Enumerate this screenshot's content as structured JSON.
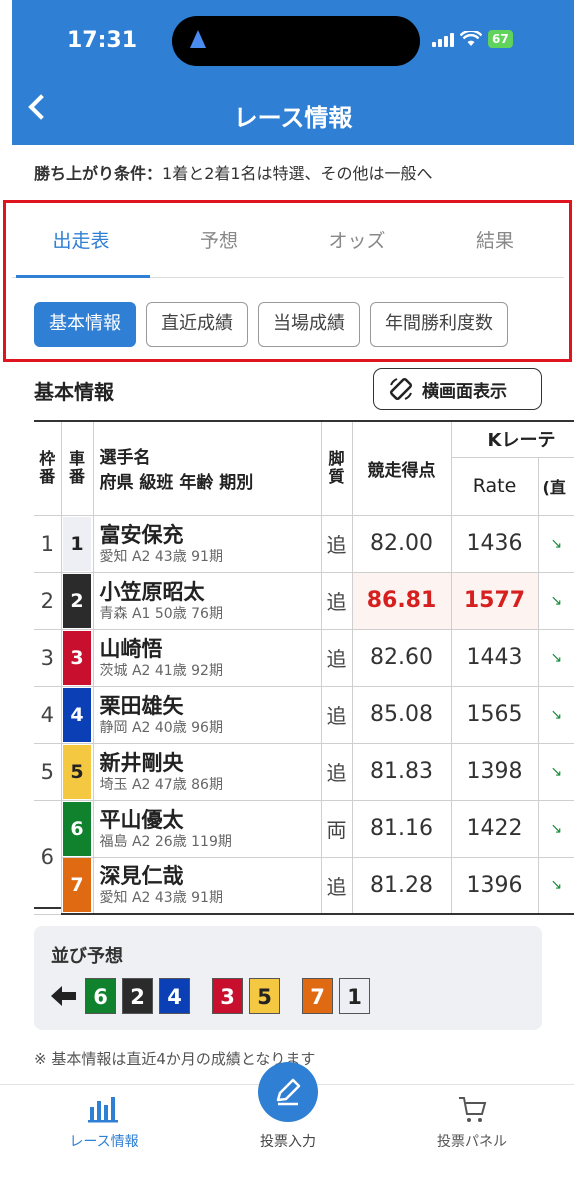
{
  "status_bar": {
    "time": "17:31",
    "battery": "67"
  },
  "header": {
    "title": "レース情報"
  },
  "condition": {
    "label": "勝ち上がり条件：",
    "text": "1着と2着1名は特選、その他は一般へ"
  },
  "tabs": [
    {
      "label": "出走表",
      "active": true
    },
    {
      "label": "予想",
      "active": false
    },
    {
      "label": "オッズ",
      "active": false
    },
    {
      "label": "結果",
      "active": false
    }
  ],
  "subtabs": [
    {
      "label": "基本情報",
      "active": true
    },
    {
      "label": "直近成績",
      "active": false
    },
    {
      "label": "当場成績",
      "active": false
    },
    {
      "label": "年間勝利度数",
      "active": false
    }
  ],
  "section": {
    "title": "基本情報",
    "landscape_button": "横画面表示"
  },
  "table": {
    "headers": {
      "frame": "枠番",
      "car": "車番",
      "rider": "選手名",
      "rider_sub": "府県 級班 年齢 期別",
      "leg": "脚質",
      "score": "競走得点",
      "krace": "Kレーテ",
      "rate": "Rate",
      "trend": "(直"
    },
    "rows": [
      {
        "frame": "1",
        "car": "1",
        "name": "富安保充",
        "profile": "愛知 A2 43歳 91期",
        "leg": "追",
        "score": "82.00",
        "rate": "1436",
        "trend": "↘",
        "color": "#eeeef5",
        "text_color": "#222",
        "highlight": false
      },
      {
        "frame": "2",
        "car": "2",
        "name": "小笠原昭太",
        "profile": "青森 A1 50歳 76期",
        "leg": "追",
        "score": "86.81",
        "rate": "1577",
        "trend": "↘",
        "color": "#2b2b2b",
        "text_color": "#fff",
        "highlight": true
      },
      {
        "frame": "3",
        "car": "3",
        "name": "山崎悟",
        "profile": "茨城 A2 41歳 92期",
        "leg": "追",
        "score": "82.60",
        "rate": "1443",
        "trend": "↘",
        "color": "#c8102e",
        "text_color": "#fff",
        "highlight": false
      },
      {
        "frame": "4",
        "car": "4",
        "name": "栗田雄矢",
        "profile": "静岡 A2 40歳 96期",
        "leg": "追",
        "score": "85.08",
        "rate": "1565",
        "trend": "↘",
        "color": "#0b3fb5",
        "text_color": "#fff",
        "highlight": false
      },
      {
        "frame": "5",
        "car": "5",
        "name": "新井剛央",
        "profile": "埼玉 A2 47歳 86期",
        "leg": "追",
        "score": "81.83",
        "rate": "1398",
        "trend": "↘",
        "color": "#f5c842",
        "text_color": "#222",
        "highlight": false
      },
      {
        "frame": "6",
        "car": "6",
        "name": "平山優太",
        "profile": "福島 A2 26歳 119期",
        "leg": "両",
        "score": "81.16",
        "rate": "1422",
        "trend": "↘",
        "color": "#10822e",
        "text_color": "#fff",
        "highlight": false
      },
      {
        "frame": "",
        "car": "7",
        "name": "深見仁哉",
        "profile": "愛知 A2 43歳 91期",
        "leg": "追",
        "score": "81.28",
        "rate": "1396",
        "trend": "↘",
        "color": "#e06a12",
        "text_color": "#fff",
        "highlight": false
      }
    ]
  },
  "narabi": {
    "title": "並び予想",
    "groups": [
      [
        {
          "n": "6",
          "color": "#10822e",
          "text": "#fff"
        },
        {
          "n": "2",
          "color": "#2b2b2b",
          "text": "#fff"
        },
        {
          "n": "4",
          "color": "#0b3fb5",
          "text": "#fff"
        }
      ],
      [
        {
          "n": "3",
          "color": "#c8102e",
          "text": "#fff"
        },
        {
          "n": "5",
          "color": "#f5c842",
          "text": "#222"
        }
      ],
      [
        {
          "n": "7",
          "color": "#e06a12",
          "text": "#fff"
        }
      ],
      [
        {
          "n": "1",
          "color": "#eeeef5",
          "text": "#222"
        }
      ]
    ]
  },
  "notes": {
    "note1": "※ 基本情報は直近4か月の成績となります"
  },
  "tabbar": [
    {
      "label": "レース情報",
      "icon": "chart-icon",
      "active": true
    },
    {
      "label": "投票入力",
      "icon": "pen-icon",
      "active": false
    },
    {
      "label": "投票パネル",
      "icon": "cart-icon",
      "active": false
    }
  ],
  "colors": {
    "primary": "#2f7fd4",
    "highlight": "#d61f1f",
    "outline": "#e0141e"
  }
}
